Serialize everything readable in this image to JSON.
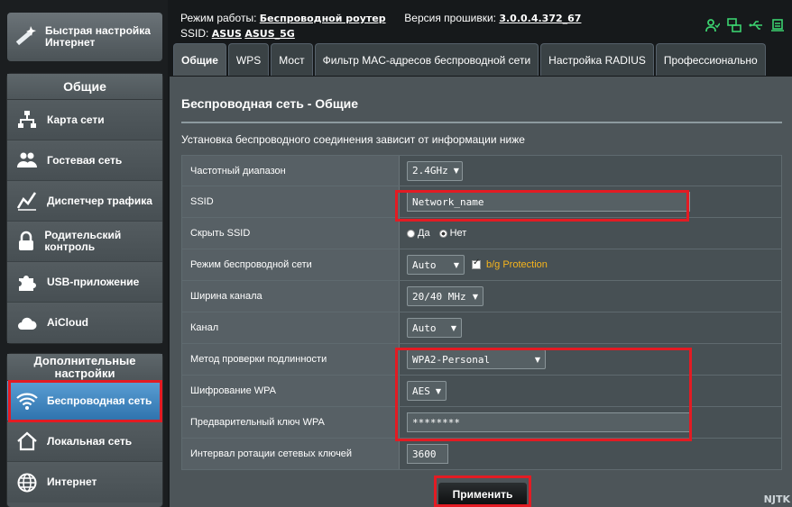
{
  "header": {
    "mode_label": "Режим работы:",
    "mode_value": "Беспроводной роутер",
    "firmware_label": "Версия прошивки:",
    "firmware_value": "3.0.0.4.372_67",
    "ssid_label": "SSID:",
    "ssid_1": "ASUS",
    "ssid_2": "ASUS_5G"
  },
  "sidebar": {
    "quick_setup": "Быстрая настройка Интернет",
    "general_header": "Общие",
    "general_items": [
      {
        "label": "Карта сети",
        "icon": "network-map-icon"
      },
      {
        "label": "Гостевая сеть",
        "icon": "guest-network-icon"
      },
      {
        "label": "Диспетчер трафика",
        "icon": "traffic-manager-icon"
      },
      {
        "label": "Родительский контроль",
        "icon": "lock-icon"
      },
      {
        "label": "USB-приложение",
        "icon": "puzzle-icon"
      },
      {
        "label": "AiCloud",
        "icon": "cloud-icon"
      }
    ],
    "advanced_header": "Дополнительные настройки",
    "advanced_items": [
      {
        "label": "Беспроводная сеть",
        "icon": "wifi-icon"
      },
      {
        "label": "Локальная сеть",
        "icon": "home-icon"
      },
      {
        "label": "Интернет",
        "icon": "globe-icon"
      }
    ]
  },
  "tabs": [
    "Общие",
    "WPS",
    "Мост",
    "Фильтр MAC-адресов беспроводной сети",
    "Настройка RADIUS",
    "Профессионально"
  ],
  "page": {
    "title": "Беспроводная сеть - Общие",
    "description": "Установка беспроводного соединения зависит от информации ниже"
  },
  "form": {
    "band_label": "Частотный диапазон",
    "band_value": "2.4GHz",
    "ssid_label": "SSID",
    "ssid_value": "Network_name",
    "hide_ssid_label": "Скрыть SSID",
    "hide_yes": "Да",
    "hide_no": "Нет",
    "mode_label": "Режим беспроводной сети",
    "mode_value": "Auto",
    "bg_protection": "b/g Protection",
    "width_label": "Ширина канала",
    "width_value": "20/40 MHz",
    "channel_label": "Канал",
    "channel_value": "Auto",
    "auth_label": "Метод проверки подлинности",
    "auth_value": "WPA2-Personal",
    "encryption_label": "Шифрование WPA",
    "encryption_value": "AES",
    "psk_label": "Предварительный ключ WPA",
    "psk_value": "********",
    "rotation_label": "Интервал ротации сетевых ключей",
    "rotation_value": "3600"
  },
  "apply_label": "Применить",
  "watermark": "NJTK",
  "colors": {
    "accent": "#2f73ad",
    "highlight": "#e31b23",
    "warning": "#f7b51c"
  }
}
